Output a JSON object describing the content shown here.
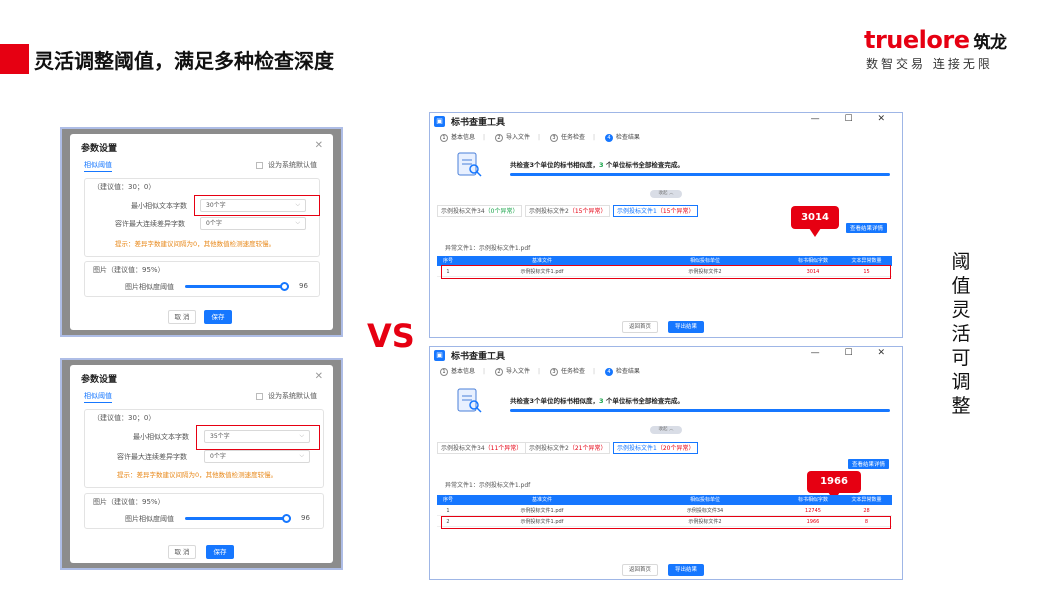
{
  "slide": {
    "title": "灵活调整阈值，满足多种检查深度",
    "brand": "truelore",
    "brand_cn": "筑龙",
    "tagline": "数智交易 连接无限",
    "vs": "VS",
    "vertical_text": "阈值灵活可调整"
  },
  "param_dialog": {
    "title": "参数设置",
    "tab": "相似阈值",
    "default_checkbox": "设为系统默认值",
    "text_section": "（建议值：30；0）",
    "min_chars_label": "最小相似文本字数",
    "tolerance_label": "容许最大连续差异字数",
    "tolerance_value": "0个字",
    "hint": "提示：差异字数建议间隔为0，其他数值检测速度较慢。",
    "image_section": "图片（建议值：95%）",
    "image_label": "图片相似度阈值",
    "image_value": "96",
    "image_threshold": 0.96,
    "cancel": "取 消",
    "save": "保存"
  },
  "dialog_top": {
    "min_chars_value": "30个字"
  },
  "dialog_bottom": {
    "min_chars_value": "35个字"
  },
  "tool": {
    "title": "标书查重工具",
    "window_controls": "— ☐ ✕",
    "steps": [
      "基本信息",
      "导入文件",
      "任务检查",
      "检查结果"
    ],
    "step_nums": [
      "1",
      "2",
      "3",
      "4"
    ],
    "banner_a": "共检查3个单位的标书相似度，",
    "banner_num": "3",
    "banner_b": "个单位标书全部检查完成。",
    "collapse": "收起 ︿",
    "detail_btn": "查看结果详情",
    "abnormal_label": "异常文件1：示例投标文件1.pdf",
    "columns": [
      "序号",
      "基准文件",
      "相似投标单位",
      "标书相似字数",
      "文本异常数量"
    ],
    "back_btn": "返回首页",
    "export_btn": "导出结果"
  },
  "tool_top": {
    "tabs": [
      {
        "name": "示例投标文件34",
        "count": "（0个异常）"
      },
      {
        "name": "示例投标文件2",
        "count": "（15个异常）"
      },
      {
        "name": "示例投标文件1",
        "count": "（15个异常）"
      }
    ],
    "callout": "3014",
    "rows": [
      {
        "no": "1",
        "base": "示例投标文件1.pdf",
        "unit": "示例投标文件2",
        "chars": "3014",
        "count": "15"
      }
    ]
  },
  "tool_bottom": {
    "tabs": [
      {
        "name": "示例投标文件34",
        "count": "（11个异常）"
      },
      {
        "name": "示例投标文件2",
        "count": "（21个异常）"
      },
      {
        "name": "示例投标文件1",
        "count": "（20个异常）"
      }
    ],
    "callout": "1966",
    "rows": [
      {
        "no": "1",
        "base": "示例投标文件1.pdf",
        "unit": "示例投标文件34",
        "chars": "12745",
        "count": "28"
      },
      {
        "no": "2",
        "base": "示例投标文件1.pdf",
        "unit": "示例投标文件2",
        "chars": "1966",
        "count": "8"
      }
    ]
  },
  "colors": {
    "brand_red": "#e60012",
    "accent_blue": "#1677ff",
    "success_green": "#19a34a",
    "hint_orange": "#e8891b"
  }
}
